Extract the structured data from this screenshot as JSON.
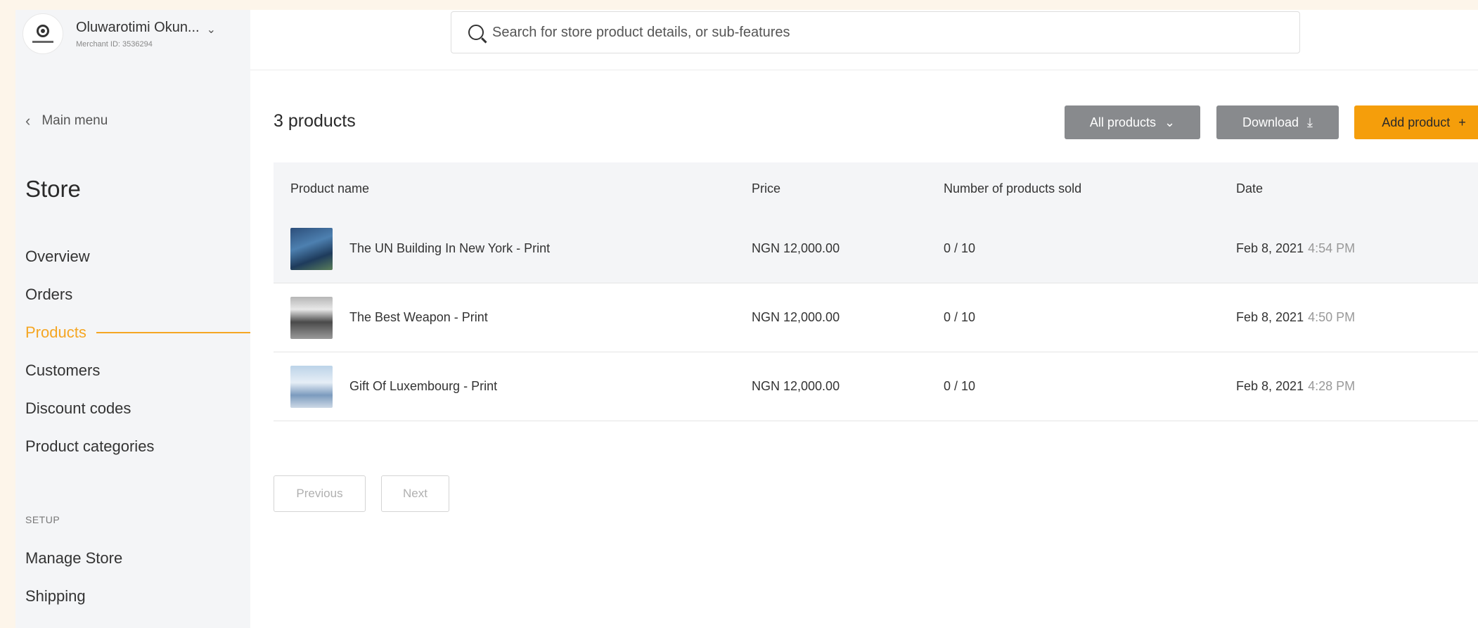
{
  "account": {
    "name": "Oluwarotimi Okun...",
    "merchant_id": "Merchant ID: 3536294"
  },
  "sidebar": {
    "back_label": "Main menu",
    "section_title": "Store",
    "items": [
      {
        "label": "Overview"
      },
      {
        "label": "Orders"
      },
      {
        "label": "Products"
      },
      {
        "label": "Customers"
      },
      {
        "label": "Discount codes"
      },
      {
        "label": "Product categories"
      }
    ],
    "active_item": "Products",
    "setup_label": "SETUP",
    "setup_items": [
      {
        "label": "Manage Store"
      },
      {
        "label": "Shipping"
      }
    ]
  },
  "search": {
    "placeholder": "Search for store product details, or sub-features"
  },
  "main": {
    "count_title": "3 products",
    "filter_label": "All products",
    "download_label": "Download",
    "add_label": "Add product",
    "columns": {
      "name": "Product name",
      "price": "Price",
      "sold": "Number of products sold",
      "date": "Date"
    },
    "rows": [
      {
        "name": "The UN Building In New York - Print",
        "price": "NGN 12,000.00",
        "sold": "0 / 10",
        "date": "Feb 8, 2021",
        "time": "4:54 PM"
      },
      {
        "name": "The Best Weapon - Print",
        "price": "NGN 12,000.00",
        "sold": "0 / 10",
        "date": "Feb 8, 2021",
        "time": "4:50 PM"
      },
      {
        "name": "Gift Of Luxembourg - Print",
        "price": "NGN 12,000.00",
        "sold": "0 / 10",
        "date": "Feb 8, 2021",
        "time": "4:28 PM"
      }
    ],
    "pagination": {
      "previous": "Previous",
      "next": "Next"
    }
  },
  "colors": {
    "accent": "#f5a623",
    "add_button": "#f59e0b",
    "secondary_button": "#888a8d",
    "sidebar_bg": "#f4f5f7",
    "page_bg": "#fdf5ea"
  },
  "icons": {
    "search": "search-icon",
    "chevron_down": "chevron-down-icon",
    "chevron_left": "chevron-left-icon",
    "download": "download-icon",
    "plus": "plus-icon"
  }
}
